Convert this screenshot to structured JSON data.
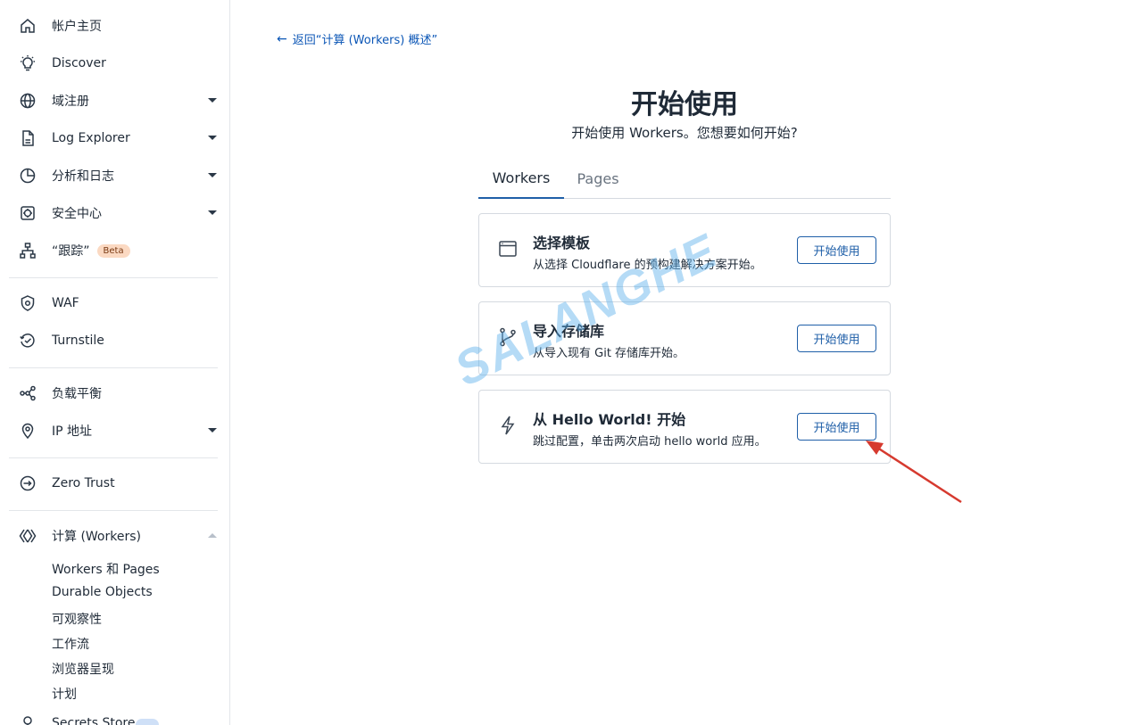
{
  "sidebar": {
    "items": [
      {
        "label": "帐户主页",
        "icon": "home-icon"
      },
      {
        "label": "Discover",
        "icon": "lightbulb-icon"
      },
      {
        "label": "域注册",
        "icon": "globe-icon"
      },
      {
        "label": "Log Explorer",
        "icon": "document-icon"
      },
      {
        "label": "分析和日志",
        "icon": "pie-chart-icon"
      },
      {
        "label": "安全中心",
        "icon": "security-center-icon"
      },
      {
        "label": "“跟踪”",
        "icon": "sitemap-icon",
        "badge": "Beta"
      },
      {
        "label": "WAF",
        "icon": "shield-icon"
      },
      {
        "label": "Turnstile",
        "icon": "turnstile-icon"
      },
      {
        "label": "负载平衡",
        "icon": "load-balancing-icon"
      },
      {
        "label": "IP 地址",
        "icon": "location-pin-icon"
      },
      {
        "label": "Zero Trust",
        "icon": "zero-trust-icon"
      },
      {
        "label": "计算 (Workers)",
        "icon": "workers-icon"
      }
    ],
    "sub_items": [
      "Workers 和 Pages",
      "Durable Objects",
      "可观察性",
      "工作流",
      "浏览器呈现",
      "计划"
    ],
    "cut_item": "Secrets Store"
  },
  "main": {
    "back_link": "返回“计算 (Workers) 概述”",
    "title": "开始使用",
    "subtitle": "开始使用 Workers。您想要如何开始?",
    "tabs": [
      {
        "label": "Workers",
        "active": true
      },
      {
        "label": "Pages",
        "active": false
      }
    ],
    "cards": [
      {
        "title": "选择模板",
        "desc": "从选择 Cloudflare 的预构建解决方案开始。",
        "button": "开始使用",
        "icon": "browser-window-icon"
      },
      {
        "title": "导入存储库",
        "desc": "从导入现有 Git 存储库开始。",
        "button": "开始使用",
        "icon": "git-branch-icon"
      },
      {
        "title": "从 Hello World! 开始",
        "desc": "跳过配置，单击两次启动 hello world 应用。",
        "button": "开始使用",
        "icon": "lightning-icon"
      }
    ]
  },
  "watermark": "SALANGHE",
  "colors": {
    "accent": "#1f5fa8",
    "link": "#0b56b6",
    "annotation_arrow": "#d63a2f",
    "beta_badge": "#fbd9c2"
  }
}
